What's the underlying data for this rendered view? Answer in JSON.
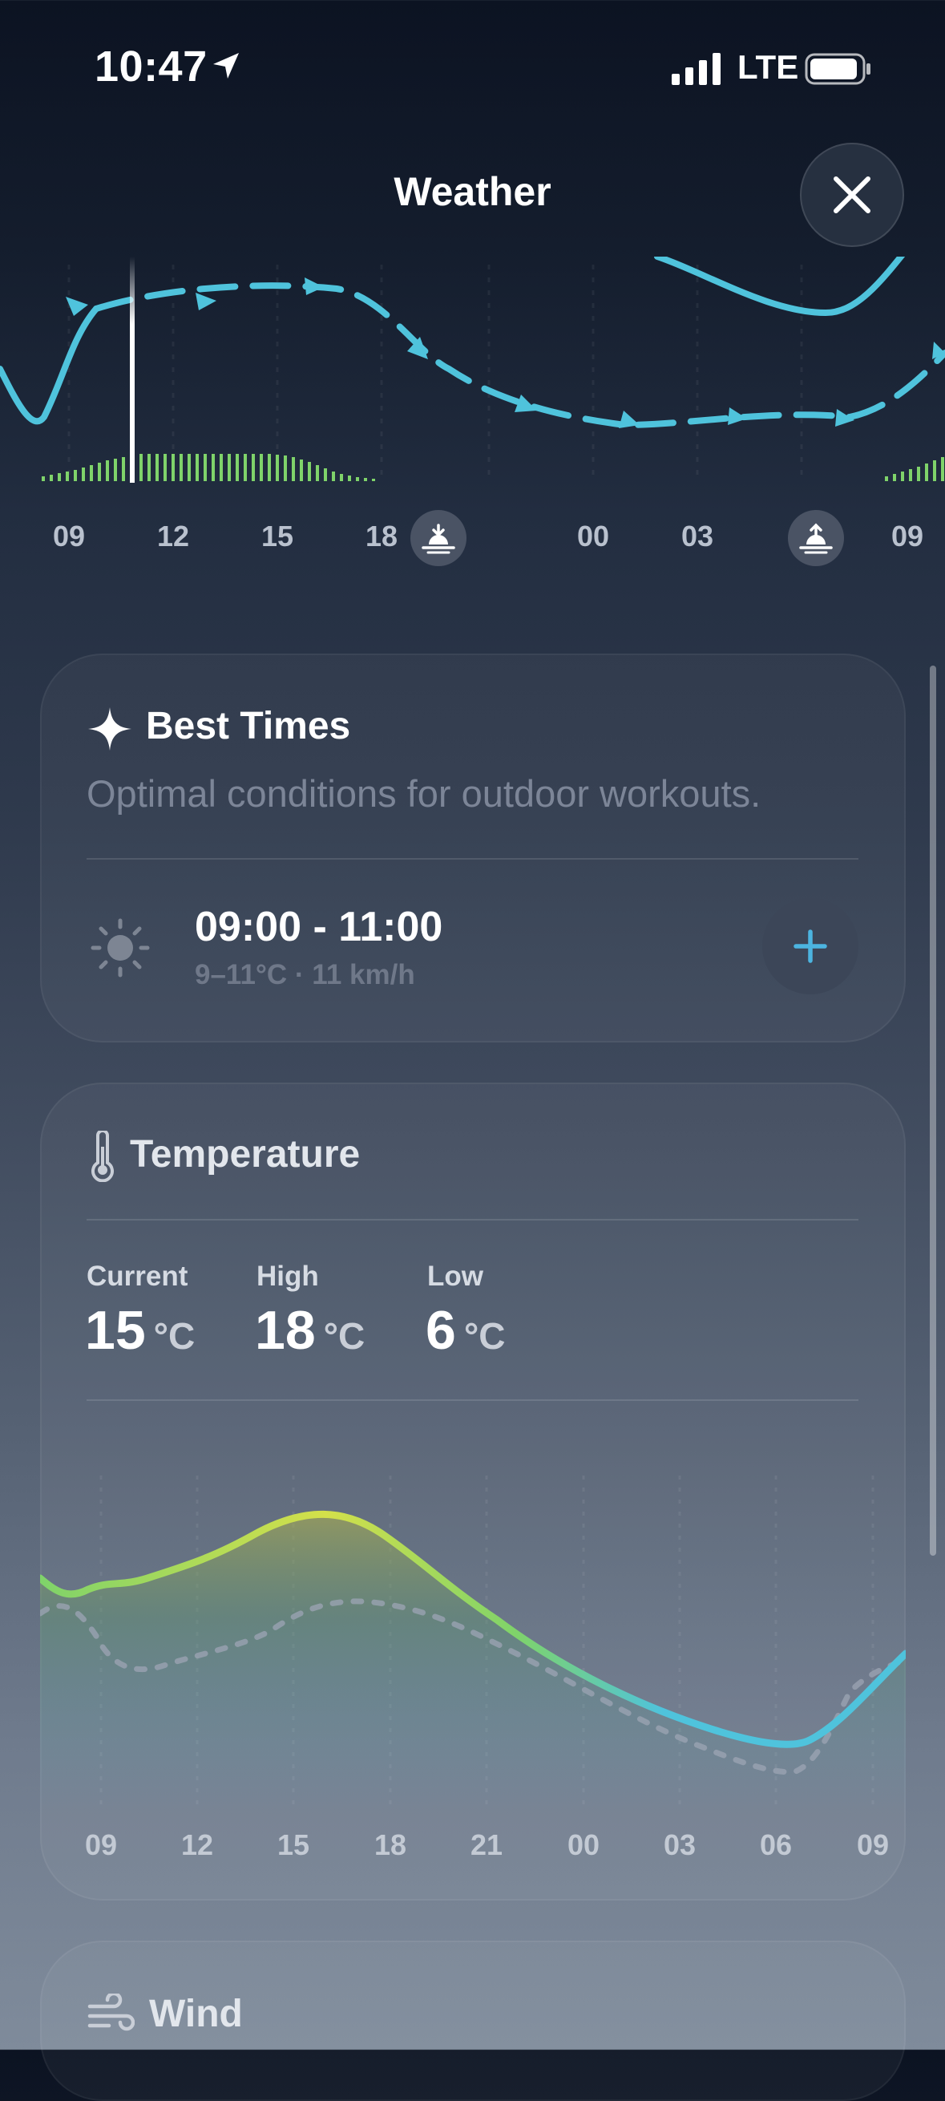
{
  "status_bar": {
    "time": "10:47",
    "network": "LTE"
  },
  "header": {
    "title": "Weather"
  },
  "top_timeline": {
    "hours": [
      "09",
      "12",
      "15",
      "18",
      "00",
      "03",
      "09"
    ],
    "sunset_icon": "sunset-icon",
    "sunrise_icon": "sunrise-icon"
  },
  "best_times": {
    "title": "Best Times",
    "subtitle": "Optimal conditions for outdoor workouts.",
    "slot": {
      "time": "09:00 - 11:00",
      "details": "9–11°C · 11 km/h"
    },
    "add_icon": "plus-icon"
  },
  "temperature": {
    "title": "Temperature",
    "stats": [
      {
        "label": "Current",
        "value": "15",
        "unit": "°C"
      },
      {
        "label": "High",
        "value": "18",
        "unit": "°C"
      },
      {
        "label": "Low",
        "value": "6",
        "unit": "°C"
      }
    ],
    "hours": [
      "09",
      "12",
      "15",
      "18",
      "21",
      "00",
      "03",
      "06",
      "09"
    ]
  },
  "wind": {
    "title": "Wind"
  },
  "colors": {
    "line": "#4fc3dc",
    "warm": "#d4e04a",
    "green": "#7fd36a"
  }
}
